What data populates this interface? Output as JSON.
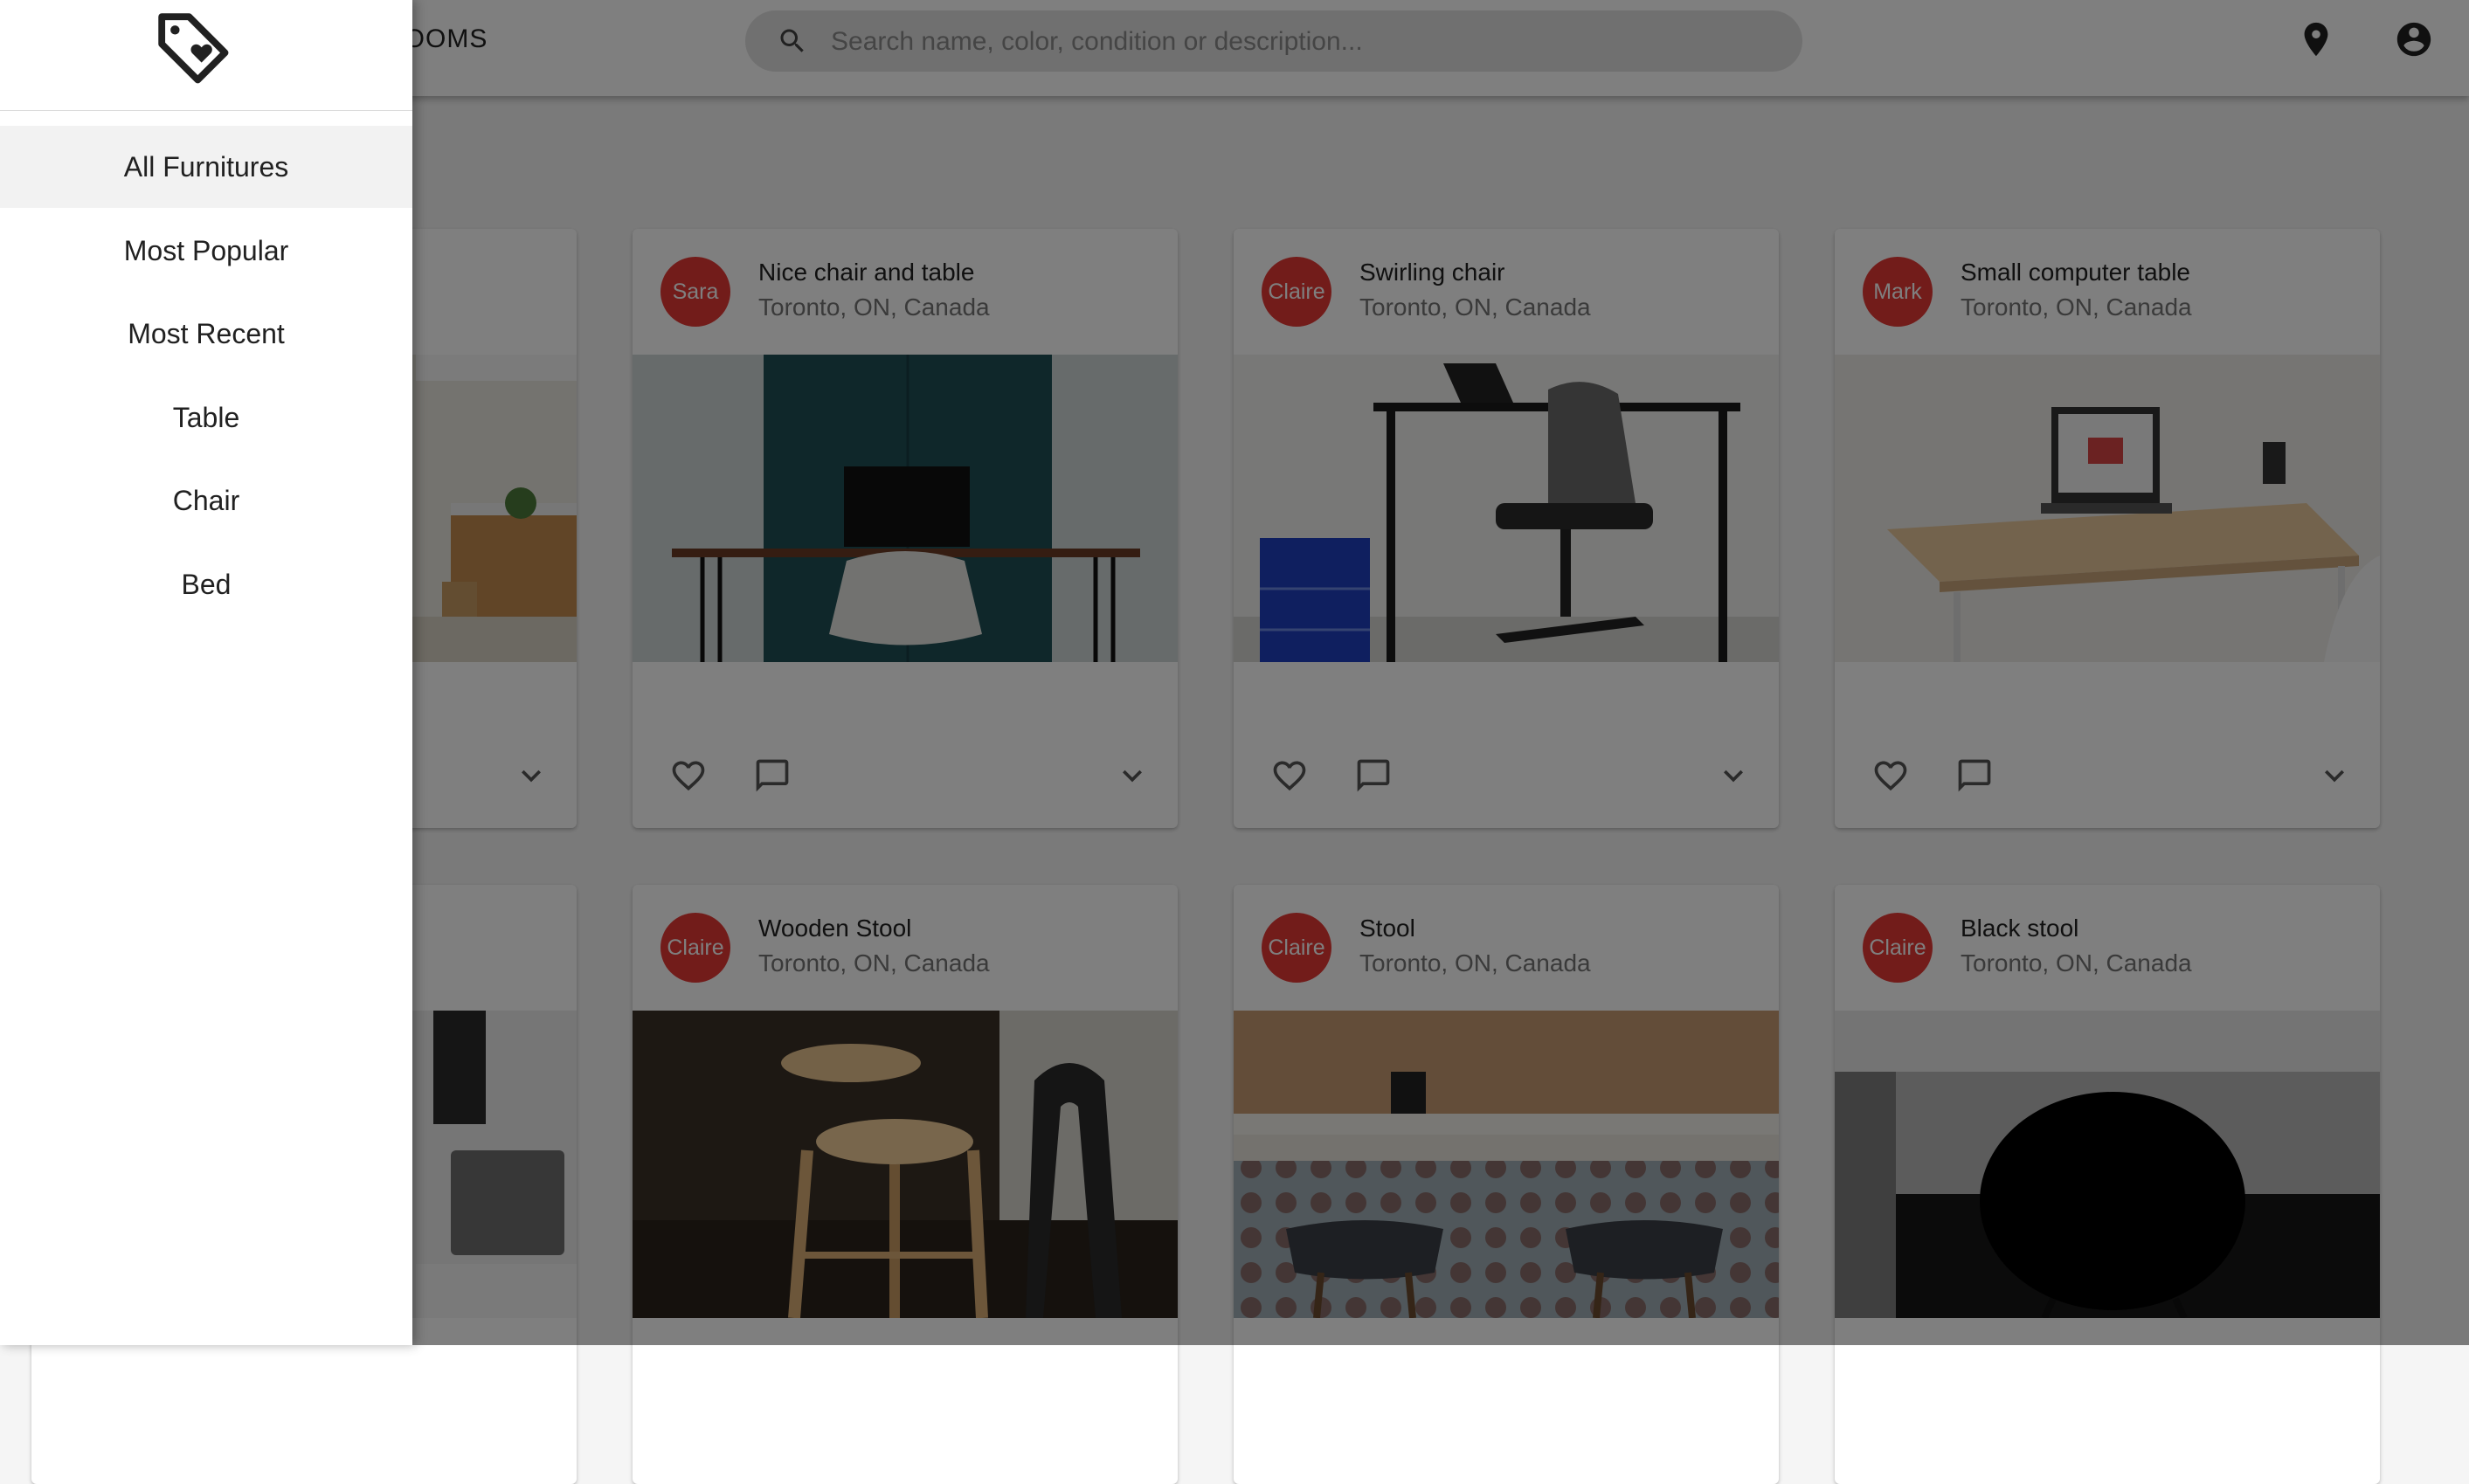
{
  "appbar": {
    "brand_text": "ROOMS",
    "search": {
      "placeholder": "Search name, color, condition or description..."
    },
    "icons": [
      "search-icon",
      "location-pin-icon",
      "account-circle-icon"
    ]
  },
  "drawer": {
    "logo_icon": "heart-tag-icon",
    "items": [
      {
        "label": "All Furnitures",
        "active": true
      },
      {
        "label": "Most Popular"
      },
      {
        "label": "Most Recent"
      },
      {
        "label": "Table"
      },
      {
        "label": "Chair"
      },
      {
        "label": "Bed"
      }
    ]
  },
  "cards": [
    {
      "avatar": "Sara",
      "title": "Nice chair and table",
      "location": "Toronto, ON, Canada",
      "image": "desk-with-laptop-and-white-chair"
    },
    {
      "avatar": "Claire",
      "title": "Swirling chair",
      "location": "Toronto, ON, Canada",
      "image": "office-swivel-chair-at-standing-desk"
    },
    {
      "avatar": "Mark",
      "title": "Small computer table",
      "location": "Toronto, ON, Canada",
      "image": "small-wooden-computer-table"
    },
    {
      "avatar": "Claire",
      "title": "Wooden Stool",
      "location": "Toronto, ON, Canada",
      "image": "wooden-bar-stools"
    },
    {
      "avatar": "Claire",
      "title": "Stool",
      "location": "Toronto, ON, Canada",
      "image": "kitchen-counter-stools"
    },
    {
      "avatar": "Claire",
      "title": "Black stool",
      "location": "Toronto, ON, Canada",
      "image": "round-black-stool"
    }
  ],
  "card_action_icons": [
    "favorite-border-icon",
    "comment-icon",
    "expand-more-icon"
  ],
  "colors": {
    "avatar": "#e53935",
    "backdrop": "rgba(0,0,0,0.5)"
  }
}
